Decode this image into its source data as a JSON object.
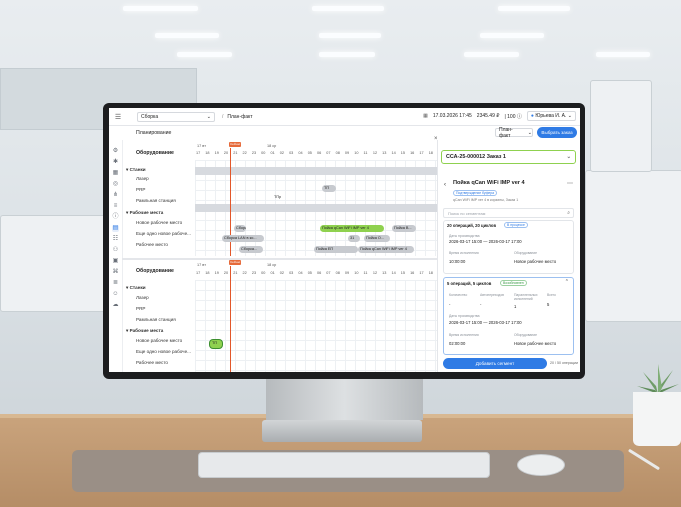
{
  "app": {
    "workspace": "Сборка",
    "breadcrumb": "План-факт",
    "datetime": "17.03.2026 17:45",
    "balance": "2345.49 ₽",
    "counter": "100",
    "user": "Юрьева И. А.",
    "page_title": "Планирование",
    "plan_select": "План-факт",
    "primary_button": "Выбрать заказ",
    "now_tag": "Сейчас"
  },
  "gantt": {
    "top": {
      "header": "Оборудование",
      "day_labels": [
        "17 вт",
        "18 ср"
      ],
      "ticks": [
        "17",
        "18",
        "19",
        "20",
        "21",
        "22",
        "23",
        "00",
        "01",
        "02",
        "03",
        "04",
        "05",
        "06",
        "07",
        "08",
        "09",
        "10",
        "11",
        "12",
        "13",
        "14",
        "15",
        "16",
        "17",
        "18"
      ],
      "group1": "Станки",
      "rows1": [
        "Лазер",
        "PRP",
        "Рамльная станция"
      ],
      "group2": "Рабочие места",
      "rows2": [
        "Новое рабочее место",
        "Еще одно новое рабоче...",
        "Рабочее место"
      ],
      "bars": [
        "ТПр",
        "ТП",
        "Сборк...",
        "Пойка qCan WiFi IMP ver 4",
        "Пойка В...",
        "Сборка LAN в ко...",
        "Пойка О...",
        "Сборка...",
        "Пойка ЕП",
        "31",
        "Пойка qCan WiFi IMP ver 4"
      ]
    },
    "bottom": {
      "header": "Оборудование",
      "day_labels": [
        "17 вт",
        "18 ср"
      ],
      "ticks": [
        "17",
        "18",
        "19",
        "20",
        "21",
        "22",
        "23",
        "00",
        "01",
        "02",
        "03",
        "04",
        "05",
        "06",
        "07",
        "08",
        "09",
        "10",
        "11",
        "12",
        "13",
        "14",
        "15",
        "16",
        "17",
        "18"
      ],
      "group1": "Станки",
      "rows1": [
        "Лазер",
        "PRP",
        "Рамльная станция"
      ],
      "group2": "Рабочие места",
      "rows2": [
        "Новое рабочее место",
        "Еще одно новое рабоче...",
        "Рабочее место"
      ],
      "bars": [
        "ТП"
      ]
    }
  },
  "panel": {
    "order": "ССА-25-000012 Заказ 1",
    "product": "Пойка qCan WiFi IMP ver 4",
    "status": "Подтверждение буфера",
    "subtitle": "qCan WiFi IMP ver 4 в корзины, Заказ 1",
    "search_placeholder": "Поиск по сегментам",
    "section1_title": "20 операций, 20 циклов",
    "section1_tag": "В процессе",
    "section1_dates_label": "Даты производства",
    "section1_dates": "2026-03-17 15:00 — 2026-03-17 17:00",
    "section1_time_label": "Время исполнения",
    "section1_time": "10:00:00",
    "section1_equipment_label": "Оборудование",
    "section1_equipment": "Новое рабочее место",
    "section2_title": "5 операций, 5 циклов",
    "section2_tag": "Возобновлен",
    "section2_cols": [
      "Количество",
      "Автопереходов",
      "Параллельных исполнений",
      "Всего"
    ],
    "section2_vals": [
      "-",
      "-",
      "1",
      "5"
    ],
    "section2_dates_label": "Даты производства",
    "section2_dates": "2026-03-17 15:00 — 2026-03-17 17:00",
    "section2_time_label": "Время исполнения",
    "section2_time": "02:00:00",
    "section2_equipment_label": "Оборудование",
    "section2_equipment": "Новое рабочее место",
    "add_button": "Добавить сегмент",
    "footer_note": "20 / 50 операции"
  },
  "colors": {
    "accent": "#2f7be5",
    "segment_green": "#8fd14f",
    "now_line": "#e2572a"
  }
}
